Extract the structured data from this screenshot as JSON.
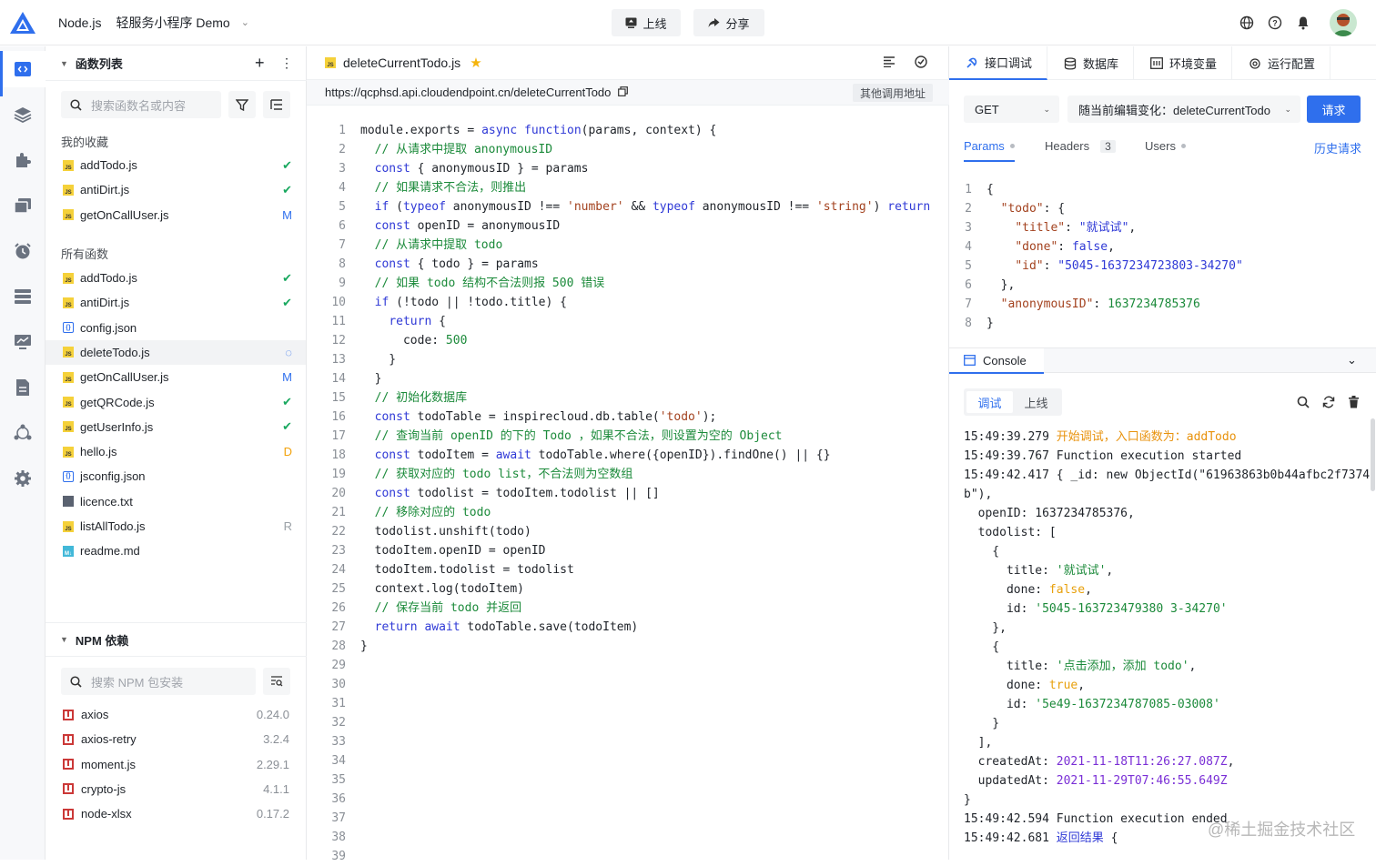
{
  "header": {
    "project": "Node.js",
    "app": "轻服务小程序 Demo",
    "deploy_label": "上线",
    "share_label": "分享"
  },
  "icons": {
    "logo": "triangle-logo-icon",
    "globe": "globe-icon",
    "help": "help-icon",
    "bell": "bell-icon"
  },
  "colors": {
    "accent": "#2f6fed",
    "ok": "#19a85f",
    "modified": "#2f6fed",
    "deleted": "#f2a20c"
  },
  "sidebar": {
    "panel_title": "函数列表",
    "search_placeholder": "搜索函数名或内容",
    "favorites_title": "我的收藏",
    "favorites": [
      {
        "name": "addTodo.js",
        "type": "js",
        "status": "✔"
      },
      {
        "name": "antiDirt.js",
        "type": "js",
        "status": "✔"
      },
      {
        "name": "getOnCallUser.js",
        "type": "js",
        "status": "M"
      }
    ],
    "all_title": "所有函数",
    "files": [
      {
        "name": "addTodo.js",
        "type": "js",
        "status": "✔"
      },
      {
        "name": "antiDirt.js",
        "type": "js",
        "status": "✔"
      },
      {
        "name": "config.json",
        "type": "json",
        "status": ""
      },
      {
        "name": "deleteTodo.js",
        "type": "js",
        "status": "◌"
      },
      {
        "name": "getOnCallUser.js",
        "type": "js",
        "status": "M"
      },
      {
        "name": "getQRCode.js",
        "type": "js",
        "status": "✔"
      },
      {
        "name": "getUserInfo.js",
        "type": "js",
        "status": "✔"
      },
      {
        "name": "hello.js",
        "type": "js",
        "status": "D"
      },
      {
        "name": "jsconfig.json",
        "type": "json",
        "status": ""
      },
      {
        "name": "licence.txt",
        "type": "txt",
        "status": ""
      },
      {
        "name": "listAllTodo.js",
        "type": "js",
        "status": "R"
      },
      {
        "name": "readme.md",
        "type": "md",
        "status": ""
      }
    ],
    "npm_title": "NPM 依赖",
    "npm_placeholder": "搜索 NPM 包安装",
    "packages": [
      {
        "name": "axios",
        "version": "0.24.0"
      },
      {
        "name": "axios-retry",
        "version": "3.2.4"
      },
      {
        "name": "moment.js",
        "version": "2.29.1"
      },
      {
        "name": "crypto-js",
        "version": "4.1.1"
      },
      {
        "name": "node-xlsx",
        "version": "0.17.2"
      }
    ]
  },
  "editor": {
    "tab": "deleteCurrentTodo.js",
    "url": "https://qcphsd.api.cloudendpoint.cn/deleteCurrentTodo",
    "other_url": "其他调用地址",
    "lines": [
      "module.exports = async function(params, context) {",
      "  // 从请求中提取 anonymousID",
      "  const { anonymousID } = params",
      "  // 如果请求不合法，则推出",
      "  if (typeof anonymousID !== 'number' && typeof anonymousID !== 'string') return",
      "  const openID = anonymousID",
      "  // 从请求中提取 todo",
      "  const { todo } = params",
      "  // 如果 todo 结构不合法则报 500 错误",
      "  if (!todo || !todo.title) {",
      "    return {",
      "      code: 500",
      "    }",
      "  }",
      "  // 初始化数据库",
      "  const todoTable = inspirecloud.db.table('todo');",
      "  // 查询当前 openID 的下的 Todo ，如果不合法，则设置为空的 Object",
      "  const todoItem = await todoTable.where({openID}).findOne() || {}",
      "  // 获取对应的 todo list，不合法则为空数组",
      "  const todolist = todoItem.todolist || []",
      "  // 移除对应的 todo",
      "  todolist.unshift(todo)",
      "  todoItem.openID = openID",
      "  todoItem.todolist = todolist",
      "  context.log(todoItem)",
      "  // 保存当前 todo 并返回",
      "  return await todoTable.save(todoItem)",
      "}",
      "",
      "",
      "",
      "",
      "",
      "",
      "",
      "",
      "",
      "",
      ""
    ]
  },
  "right": {
    "tabs": [
      "接口调试",
      "数据库",
      "环境变量",
      "运行配置"
    ],
    "method": "GET",
    "source": "随当前编辑变化：deleteCurrentTodo",
    "request_label": "请求",
    "subtabs": {
      "params": "Params",
      "headers": "Headers",
      "headers_count": "3",
      "users": "Users",
      "history": "历史请求"
    },
    "body_lines": [
      "{",
      "  \"todo\": {",
      "    \"title\": \"就试试\",",
      "    \"done\": false,",
      "    \"id\": \"5045-1637234723803-34270\"",
      "  },",
      "  \"anonymousID\": 1637234785376",
      "}"
    ],
    "console_title": "Console",
    "console_modes": [
      "调试",
      "上线"
    ],
    "console_lines": [
      "15:49:39.279 开始调试，入口函数为：addTodo",
      "15:49:39.767 Function execution started",
      "15:49:42.417 { _id: new ObjectId(\"61963863b0b44afbc2f7374",
      "b\"),",
      "  openID: 1637234785376,",
      "  todolist: [",
      "    {",
      "      title: '就试试',",
      "      done: false,",
      "      id: '5045-163723479380 3-34270'",
      "    },",
      "    {",
      "      title: '点击添加，添加 todo',",
      "      done: true,",
      "      id: '5e49-1637234787085-03008'",
      "    }",
      "  ],",
      "  createdAt: 2021-11-18T11:26:27.087Z,",
      "  updatedAt: 2021-11-29T07:46:55.649Z",
      "}",
      "15:49:42.594 Function execution ended",
      "15:49:42.681 返回结果 {"
    ]
  },
  "watermark": "@稀土掘金技术社区"
}
